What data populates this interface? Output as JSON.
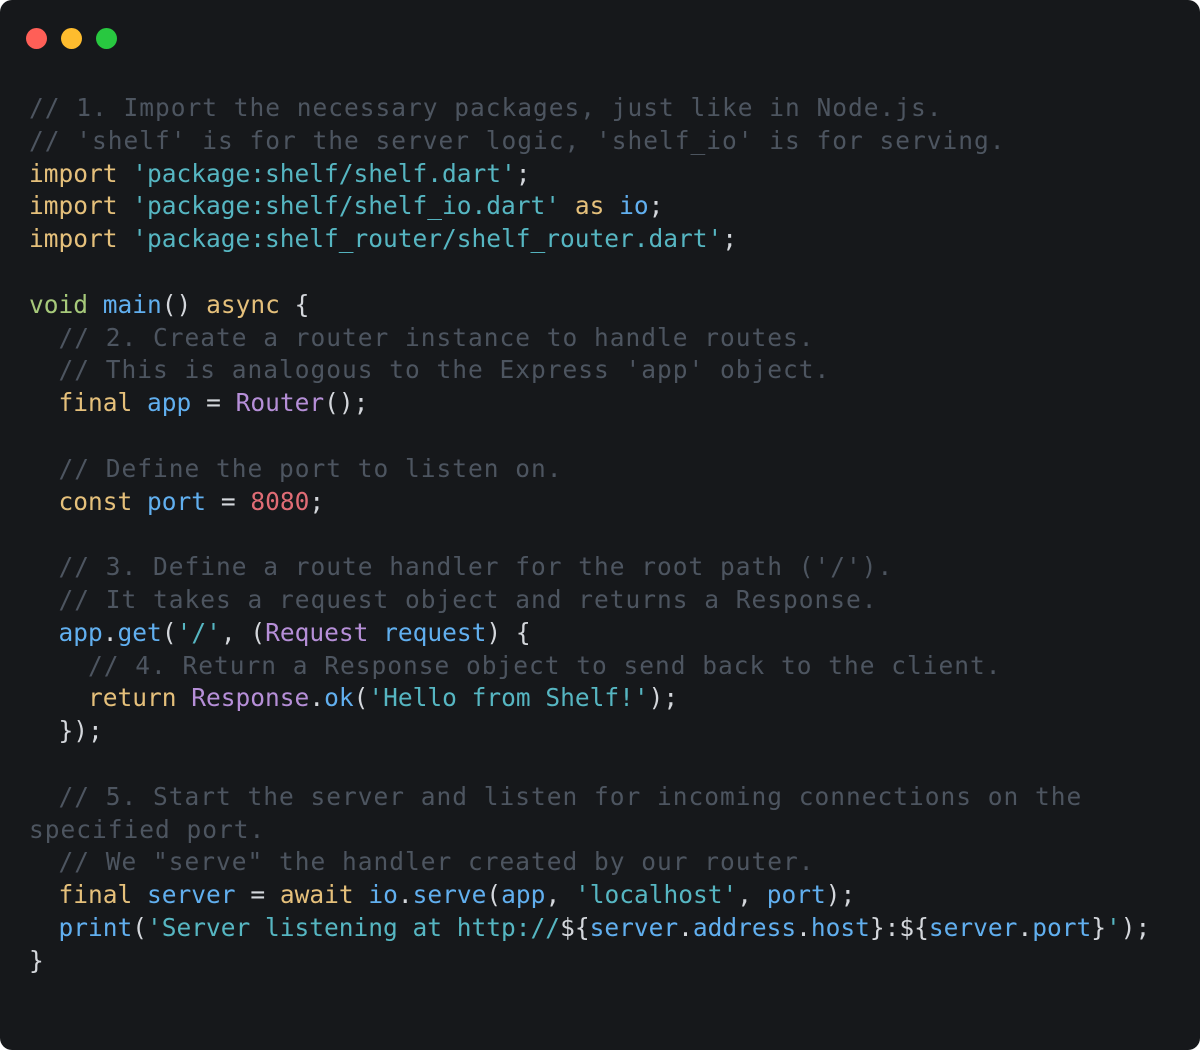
{
  "window": {
    "traffic_lights": [
      {
        "name": "close-button",
        "color": "#ff5f57"
      },
      {
        "name": "minimize-button",
        "color": "#febc2e"
      },
      {
        "name": "maximize-button",
        "color": "#28c840"
      }
    ]
  },
  "editor": {
    "language": "dart",
    "lines": [
      [
        {
          "t": "comment",
          "v": "// 1. Import the necessary packages, just like in Node.js."
        }
      ],
      [
        {
          "t": "comment",
          "v": "// 'shelf' is for the server logic, 'shelf_io' is for serving."
        }
      ],
      [
        {
          "t": "keyword",
          "v": "import"
        },
        {
          "t": "plain",
          "v": " "
        },
        {
          "t": "string",
          "v": "'package:shelf/shelf.dart'"
        },
        {
          "t": "plain",
          "v": ";"
        }
      ],
      [
        {
          "t": "keyword",
          "v": "import"
        },
        {
          "t": "plain",
          "v": " "
        },
        {
          "t": "string",
          "v": "'package:shelf/shelf_io.dart'"
        },
        {
          "t": "plain",
          "v": " "
        },
        {
          "t": "keyword",
          "v": "as"
        },
        {
          "t": "plain",
          "v": " "
        },
        {
          "t": "func",
          "v": "io"
        },
        {
          "t": "plain",
          "v": ";"
        }
      ],
      [
        {
          "t": "keyword",
          "v": "import"
        },
        {
          "t": "plain",
          "v": " "
        },
        {
          "t": "string",
          "v": "'package:shelf_router/shelf_router.dart'"
        },
        {
          "t": "plain",
          "v": ";"
        }
      ],
      [],
      [
        {
          "t": "void",
          "v": "void"
        },
        {
          "t": "plain",
          "v": " "
        },
        {
          "t": "func",
          "v": "main"
        },
        {
          "t": "plain",
          "v": "() "
        },
        {
          "t": "keyword",
          "v": "async"
        },
        {
          "t": "plain",
          "v": " {"
        }
      ],
      [
        {
          "t": "plain",
          "v": "  "
        },
        {
          "t": "comment",
          "v": "// 2. Create a router instance to handle routes."
        }
      ],
      [
        {
          "t": "plain",
          "v": "  "
        },
        {
          "t": "comment",
          "v": "// This is analogous to the Express 'app' object."
        }
      ],
      [
        {
          "t": "plain",
          "v": "  "
        },
        {
          "t": "keyword",
          "v": "final"
        },
        {
          "t": "plain",
          "v": " "
        },
        {
          "t": "func",
          "v": "app"
        },
        {
          "t": "plain",
          "v": " = "
        },
        {
          "t": "type",
          "v": "Router"
        },
        {
          "t": "plain",
          "v": "();"
        }
      ],
      [],
      [
        {
          "t": "plain",
          "v": "  "
        },
        {
          "t": "comment",
          "v": "// Define the port to listen on."
        }
      ],
      [
        {
          "t": "plain",
          "v": "  "
        },
        {
          "t": "keyword",
          "v": "const"
        },
        {
          "t": "plain",
          "v": " "
        },
        {
          "t": "func",
          "v": "port"
        },
        {
          "t": "plain",
          "v": " = "
        },
        {
          "t": "number",
          "v": "8080"
        },
        {
          "t": "plain",
          "v": ";"
        }
      ],
      [],
      [
        {
          "t": "plain",
          "v": "  "
        },
        {
          "t": "comment",
          "v": "// 3. Define a route handler for the root path ('/')."
        }
      ],
      [
        {
          "t": "plain",
          "v": "  "
        },
        {
          "t": "comment",
          "v": "// It takes a request object and returns a Response."
        }
      ],
      [
        {
          "t": "plain",
          "v": "  "
        },
        {
          "t": "func",
          "v": "app"
        },
        {
          "t": "plain",
          "v": "."
        },
        {
          "t": "func",
          "v": "get"
        },
        {
          "t": "plain",
          "v": "("
        },
        {
          "t": "string",
          "v": "'/'"
        },
        {
          "t": "plain",
          "v": ", ("
        },
        {
          "t": "type",
          "v": "Request"
        },
        {
          "t": "plain",
          "v": " "
        },
        {
          "t": "func",
          "v": "request"
        },
        {
          "t": "plain",
          "v": ") {"
        }
      ],
      [
        {
          "t": "plain",
          "v": "    "
        },
        {
          "t": "comment",
          "v": "// 4. Return a Response object to send back to the client."
        }
      ],
      [
        {
          "t": "plain",
          "v": "    "
        },
        {
          "t": "keyword",
          "v": "return"
        },
        {
          "t": "plain",
          "v": " "
        },
        {
          "t": "type",
          "v": "Response"
        },
        {
          "t": "plain",
          "v": "."
        },
        {
          "t": "func",
          "v": "ok"
        },
        {
          "t": "plain",
          "v": "("
        },
        {
          "t": "string",
          "v": "'Hello from Shelf!'"
        },
        {
          "t": "plain",
          "v": ");"
        }
      ],
      [
        {
          "t": "plain",
          "v": "  });"
        }
      ],
      [],
      [
        {
          "t": "plain",
          "v": "  "
        },
        {
          "t": "comment",
          "v": "// 5. Start the server and listen for incoming connections on the"
        }
      ],
      [
        {
          "t": "comment",
          "v": "specified port."
        }
      ],
      [
        {
          "t": "plain",
          "v": "  "
        },
        {
          "t": "comment",
          "v": "// We \"serve\" the handler created by our router."
        }
      ],
      [
        {
          "t": "plain",
          "v": "  "
        },
        {
          "t": "keyword",
          "v": "final"
        },
        {
          "t": "plain",
          "v": " "
        },
        {
          "t": "func",
          "v": "server"
        },
        {
          "t": "plain",
          "v": " = "
        },
        {
          "t": "keyword",
          "v": "await"
        },
        {
          "t": "plain",
          "v": " "
        },
        {
          "t": "func",
          "v": "io"
        },
        {
          "t": "plain",
          "v": "."
        },
        {
          "t": "func",
          "v": "serve"
        },
        {
          "t": "plain",
          "v": "("
        },
        {
          "t": "func",
          "v": "app"
        },
        {
          "t": "plain",
          "v": ", "
        },
        {
          "t": "string",
          "v": "'localhost'"
        },
        {
          "t": "plain",
          "v": ", "
        },
        {
          "t": "func",
          "v": "port"
        },
        {
          "t": "plain",
          "v": ");"
        }
      ],
      [
        {
          "t": "plain",
          "v": "  "
        },
        {
          "t": "func",
          "v": "print"
        },
        {
          "t": "plain",
          "v": "("
        },
        {
          "t": "string",
          "v": "'Server listening at http://"
        },
        {
          "t": "plain",
          "v": "${"
        },
        {
          "t": "func",
          "v": "server"
        },
        {
          "t": "plain",
          "v": "."
        },
        {
          "t": "func",
          "v": "address"
        },
        {
          "t": "plain",
          "v": "."
        },
        {
          "t": "func",
          "v": "host"
        },
        {
          "t": "plain",
          "v": "}:${"
        },
        {
          "t": "func",
          "v": "server"
        },
        {
          "t": "plain",
          "v": "."
        },
        {
          "t": "func",
          "v": "port"
        },
        {
          "t": "plain",
          "v": "}"
        },
        {
          "t": "string",
          "v": "'"
        },
        {
          "t": "plain",
          "v": ");"
        }
      ],
      [
        {
          "t": "plain",
          "v": "}"
        }
      ]
    ]
  }
}
